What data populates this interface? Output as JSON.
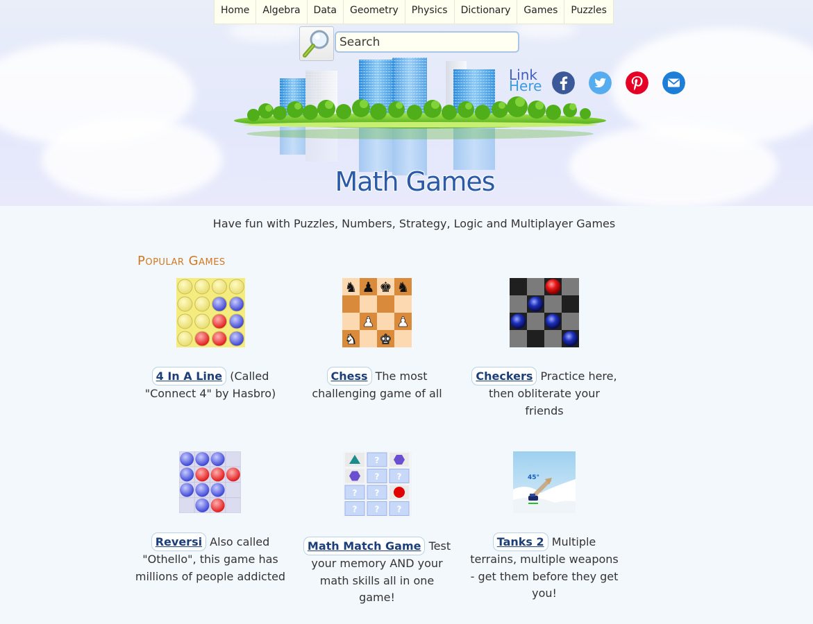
{
  "nav": {
    "items": [
      "Home",
      "Algebra",
      "Data",
      "Geometry",
      "Physics",
      "Dictionary",
      "Games",
      "Puzzles"
    ]
  },
  "search": {
    "placeholder": "Search"
  },
  "link_here": {
    "line1": "Link",
    "line2": "Here"
  },
  "social": [
    "facebook-icon",
    "twitter-icon",
    "pinterest-icon",
    "email-icon"
  ],
  "header": {
    "title": "Math Games"
  },
  "tagline": "Have fun with Puzzles, Numbers, Strategy, Logic and Multiplayer Games",
  "section_heading": "Popular Games",
  "games": [
    {
      "name": "4 In A Line",
      "desc": "(Called \"Connect 4\" by Hasbro)"
    },
    {
      "name": "Chess",
      "desc": "The most challenging game of all"
    },
    {
      "name": "Checkers",
      "desc": "Practice here, then obliterate your friends"
    },
    {
      "name": "Reversi",
      "desc": "Also called \"Othello\", this game has millions of people addicted"
    },
    {
      "name": "Math Match Game",
      "desc": "Test your memory AND your math skills all in one game!"
    },
    {
      "name": "Tanks 2",
      "desc": "Multiple terrains, multiple weapons - get them before they get you!"
    }
  ],
  "tank_angle_label": "45°",
  "colors": {
    "accent_heading": "#d07820",
    "link": "#1c3f7a",
    "title_blue": "#2a5aa8",
    "facebook": "#3b5998",
    "twitter": "#55acee",
    "pinterest": "#e60023",
    "email": "#1c7ed6"
  }
}
